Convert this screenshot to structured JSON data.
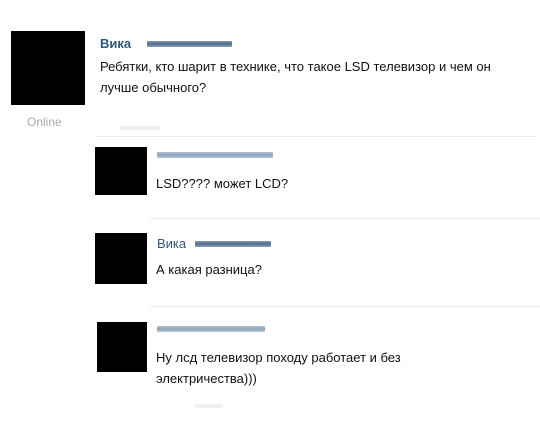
{
  "post": {
    "author": "Вика",
    "text": "Ребятки, кто шарит в технике, что такое LSD телевизор и чем он лучше обычного?",
    "status": "Online"
  },
  "comments": [
    {
      "author": "",
      "text": "LSD???? может LCD?"
    },
    {
      "author": "Вика",
      "text": "А какая разница?"
    },
    {
      "author": "",
      "text": "Ну лсд телевизор походу работает и без электричества)))"
    }
  ]
}
